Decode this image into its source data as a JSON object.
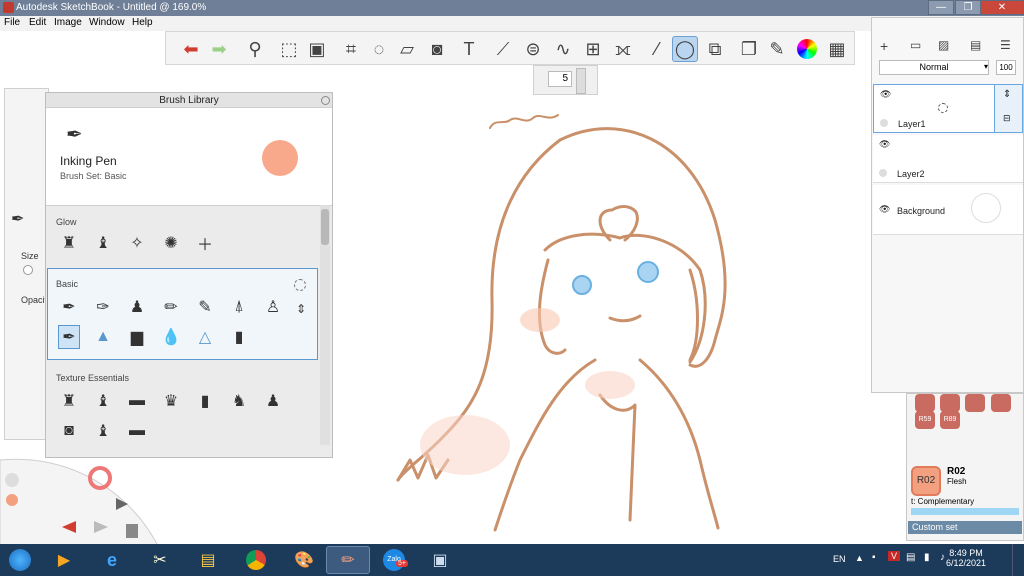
{
  "window": {
    "title": "Autodesk SketchBook - Untitled @ 169.0%",
    "minimize": "—",
    "maximize": "❐",
    "close": "✕"
  },
  "menu": [
    "File",
    "Edit",
    "Image",
    "Window",
    "Help"
  ],
  "toolbar": {
    "icons": [
      "undo-icon",
      "redo-icon",
      "zoom-icon",
      "selection-icon",
      "transform-select-icon",
      "crop-icon",
      "lasso-icon",
      "perspective-icon",
      "fill-icon",
      "text-icon",
      "ruler-icon",
      "ellipse-guide-icon",
      "french-curve-icon",
      "perspective-grid-icon",
      "symmetry-icon",
      "stroke-icon",
      "ellipse-icon",
      "shape-icon",
      "copy-paste-icon",
      "brush-palette-icon",
      "color-wheel-icon",
      "panels-icon"
    ],
    "active_index": 16
  },
  "brush_size": {
    "value": "5"
  },
  "brush_props": {
    "size_label": "Size",
    "opacity_label": "Opacit"
  },
  "brush_library": {
    "title": "Brush Library",
    "current_brush": "Inking Pen",
    "brush_set": "Brush Set: Basic",
    "current_color": "#f9a98b",
    "sections": [
      {
        "name": "Glow",
        "count": 5
      },
      {
        "name": "Basic",
        "count": 13,
        "selected_index": 7
      },
      {
        "name": "Texture Essentials",
        "count": 10
      }
    ]
  },
  "layers": {
    "blend_mode": "Normal",
    "opacity": "100",
    "items": [
      {
        "name": "Layer1",
        "selected": true
      },
      {
        "name": "Layer2",
        "selected": false
      },
      {
        "name": "Background",
        "selected": false
      }
    ]
  },
  "copic": {
    "swatch_top": [
      "R59",
      "R89"
    ],
    "selected_code": "R02",
    "selected_name": "Flesh",
    "complementary_label": "t: Complementary",
    "custom_set_label": "Custom set",
    "selected_color": "#f2a080"
  },
  "taskbar": {
    "lang": "EN",
    "time": "8:49 PM",
    "date": "6/12/2021",
    "zalo_badge": "5+"
  },
  "canvas": {
    "stroke_color": "#c9906a",
    "scribble_text": "llorrnl"
  }
}
